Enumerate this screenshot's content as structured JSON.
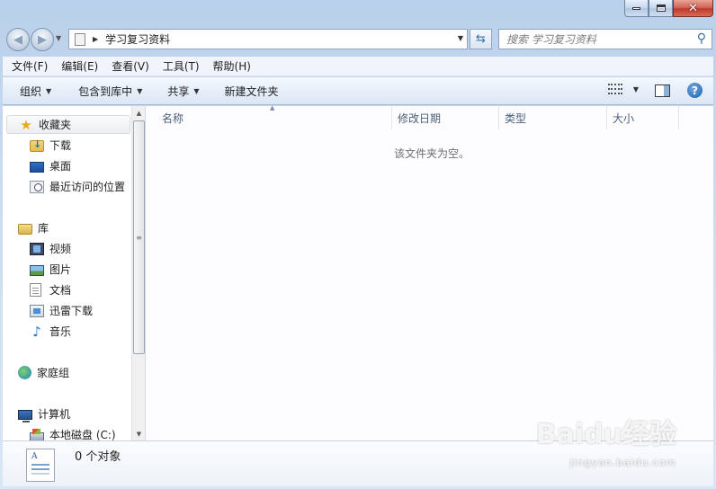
{
  "window": {
    "minimize": "minimize",
    "maximize": "maximize",
    "close": "close"
  },
  "address": {
    "path": "学习复习资料"
  },
  "search": {
    "placeholder": "搜索 学习复习资料"
  },
  "menubar": {
    "items": [
      "文件(F)",
      "编辑(E)",
      "查看(V)",
      "工具(T)",
      "帮助(H)"
    ]
  },
  "commandbar": {
    "organize": "组织",
    "include_in_library": "包含到库中",
    "share": "共享",
    "new_folder": "新建文件夹"
  },
  "navpane": {
    "favorites": "收藏夹",
    "downloads": "下载",
    "desktop": "桌面",
    "recent_places": "最近访问的位置",
    "libraries": "库",
    "videos": "视频",
    "pictures": "图片",
    "documents": "文档",
    "xunlei_downloads": "迅雷下载",
    "music": "音乐",
    "homegroup": "家庭组",
    "computer": "计算机",
    "local_disk": "本地磁盘 (C:)"
  },
  "columns": {
    "name": "名称",
    "date_modified": "修改日期",
    "type": "类型",
    "size": "大小"
  },
  "content": {
    "empty_message": "该文件夹为空。"
  },
  "details": {
    "item_count": "0 个对象"
  },
  "watermark": {
    "brand": "Baidu经验",
    "url": "jingyan.baidu.com"
  },
  "colors": {
    "frame": "#c7d8ec",
    "command_bar": "#e6eef9",
    "content_bg": "#fdfcfe",
    "close_button": "#c0392b"
  }
}
